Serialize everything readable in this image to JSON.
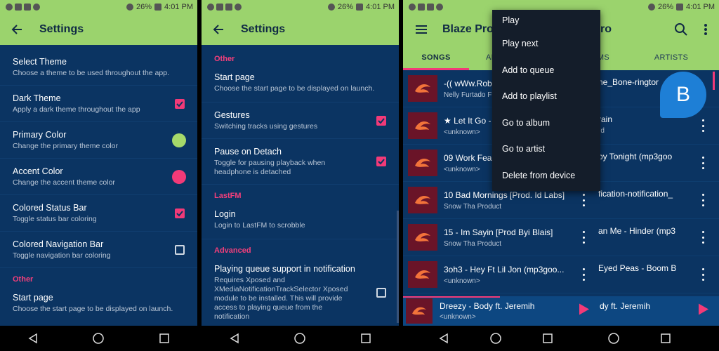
{
  "status": {
    "battery": "26%",
    "time": "4:01 PM"
  },
  "panel1": {
    "title": "Settings",
    "prefs": [
      {
        "title": "Select Theme",
        "sub": "Choose a theme to be used throughout the app."
      },
      {
        "title": "Dark Theme",
        "sub": "Apply a dark theme throughout the app"
      },
      {
        "title": "Primary Color",
        "sub": "Change the primary theme color"
      },
      {
        "title": "Accent Color",
        "sub": "Change the accent theme color"
      },
      {
        "title": "Colored Status Bar",
        "sub": "Toggle status bar coloring"
      },
      {
        "title": "Colored Navigation Bar",
        "sub": "Toggle navigation bar coloring"
      }
    ],
    "category_other": "Other",
    "start_page": {
      "title": "Start page",
      "sub": "Choose the start page to be displayed on launch."
    }
  },
  "panel2": {
    "title": "Settings",
    "cat_other": "Other",
    "start_page": {
      "title": "Start page",
      "sub": "Choose the start page to be displayed on launch."
    },
    "gestures": {
      "title": "Gestures",
      "sub": "Switching tracks using gestures"
    },
    "pause": {
      "title": "Pause on Detach",
      "sub": "Toggle for pausing playback when headphone is detached"
    },
    "cat_lastfm": "LastFM",
    "login": {
      "title": "Login",
      "sub": "Login to LastFM to scrobble"
    },
    "cat_advanced": "Advanced",
    "queue": {
      "title": "Playing queue support in notification",
      "sub": "Requires Xposed and XMediaNotificationTrackSelector Xposed module to be installed. This will provide access to playing queue from the notification"
    }
  },
  "panel3": {
    "app_title": "Blaze Pro",
    "app_title_tail": "ro",
    "tabs": [
      "SONGS",
      "AL",
      "ALBUMS",
      "ARTISTS"
    ],
    "songs": [
      {
        "title": "-(( wWw.Rob",
        "artist": "Nelly Furtado Ft",
        "right": "he_Bone-ringtor"
      },
      {
        "title": "★ Let It Go -",
        "artist": "<unknown>",
        "right": "rain",
        "right_sub": "rd"
      },
      {
        "title": "09 Work Fea",
        "artist": "<unknown>",
        "right": "by Tonight (mp3goo"
      },
      {
        "title": "10 Bad Mornings [Prod. Id Labs]",
        "artist": "Snow Tha Product",
        "right": "fication-notification_"
      },
      {
        "title": "15 - Im Sayin [Prod Byi Blais]",
        "artist": "Snow Tha Product",
        "right": "an Me - Hinder (mp3"
      },
      {
        "title": "3oh3 - Hey Ft Lil Jon (mp3goo...",
        "artist": "<unknown>",
        "right": "Eyed Peas - Boom B"
      }
    ],
    "now_playing": {
      "title": "Dreezy - Body ft. Jeremih",
      "artist": "<unknown>",
      "title_right": "dy ft. Jeremih"
    },
    "menu": [
      "Play",
      "Play next",
      "Add to queue",
      "Add to playlist",
      "Go to album",
      "Go to artist",
      "Delete from device"
    ],
    "bubble_letter": "B"
  },
  "colors": {
    "primary": "#9bd36d",
    "accent": "#f23a78",
    "background": "#0b3462",
    "swatch_primary": "#a6d96a",
    "swatch_accent": "#f23a78"
  }
}
